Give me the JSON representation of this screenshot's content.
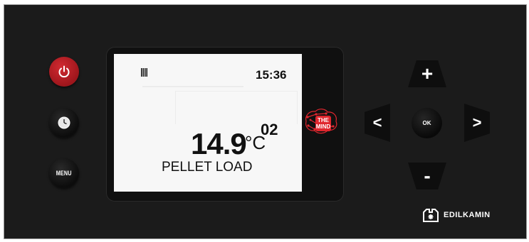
{
  "display": {
    "time": "15:36",
    "temperature": "14.9",
    "unit": "°C",
    "superscript": "02",
    "status": "PELLET LOAD"
  },
  "controls": {
    "menu_label": "MENU",
    "ok_label": "OK",
    "plus_label": "+",
    "minus_label": "-",
    "left_label": "<",
    "right_label": ">"
  },
  "logo": {
    "mind_line1": "THE",
    "mind_line2": "MIND"
  },
  "brand": {
    "name": "EDILKAMIN"
  },
  "colors": {
    "panel": "#1b1b1b",
    "power_button": "#c41f26",
    "mind_red": "#e0262e",
    "screen": "#f7f7f7"
  },
  "icons": [
    "power-icon",
    "clock-icon",
    "heating-bars-icon",
    "the-mind-logo",
    "edilkamin-logo"
  ]
}
